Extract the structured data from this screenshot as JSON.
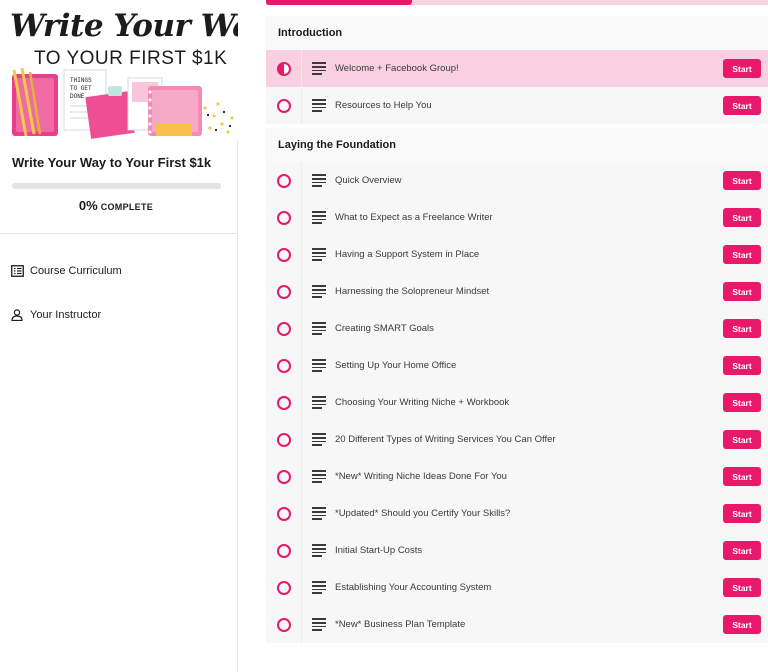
{
  "sidebar": {
    "cover": {
      "title_script": "Write Your Way",
      "subtitle": "TO YOUR FIRST $1K",
      "note_text": "THINGS TO GET DONE"
    },
    "course_title": "Write Your Way to Your First $1k",
    "progress": {
      "percent_label": "0%",
      "word": "COMPLETE",
      "fraction": 0
    },
    "nav": [
      {
        "label": "Course Curriculum",
        "icon": "list-icon"
      },
      {
        "label": "Your Instructor",
        "icon": "person-icon"
      }
    ]
  },
  "colors": {
    "accent": "#e8196b",
    "active_row": "#f9d0e0",
    "tab_track": "#f7d3e1"
  },
  "sections": [
    {
      "title": "Introduction",
      "lessons": [
        {
          "title": "Welcome + Facebook Group!",
          "action": "Start",
          "state": "in-progress"
        },
        {
          "title": "Resources to Help You",
          "action": "Start",
          "state": "not-started"
        }
      ]
    },
    {
      "title": "Laying the Foundation",
      "lessons": [
        {
          "title": "Quick Overview",
          "action": "Start",
          "state": "not-started"
        },
        {
          "title": "What to Expect as a Freelance Writer",
          "action": "Start",
          "state": "not-started"
        },
        {
          "title": "Having a Support System in Place",
          "action": "Start",
          "state": "not-started"
        },
        {
          "title": "Harnessing the Solopreneur Mindset",
          "action": "Start",
          "state": "not-started"
        },
        {
          "title": "Creating SMART Goals",
          "action": "Start",
          "state": "not-started"
        },
        {
          "title": "Setting Up Your Home Office",
          "action": "Start",
          "state": "not-started"
        },
        {
          "title": "Choosing Your Writing Niche + Workbook",
          "action": "Start",
          "state": "not-started"
        },
        {
          "title": "20 Different Types of Writing Services You Can Offer",
          "action": "Start",
          "state": "not-started"
        },
        {
          "title": "*New* Writing Niche Ideas Done For You",
          "action": "Start",
          "state": "not-started"
        },
        {
          "title": "*Updated* Should you Certify Your Skills?",
          "action": "Start",
          "state": "not-started"
        },
        {
          "title": "Initial Start-Up Costs",
          "action": "Start",
          "state": "not-started"
        },
        {
          "title": "Establishing Your Accounting System",
          "action": "Start",
          "state": "not-started"
        },
        {
          "title": "*New* Business Plan Template",
          "action": "Start",
          "state": "not-started"
        }
      ]
    }
  ]
}
